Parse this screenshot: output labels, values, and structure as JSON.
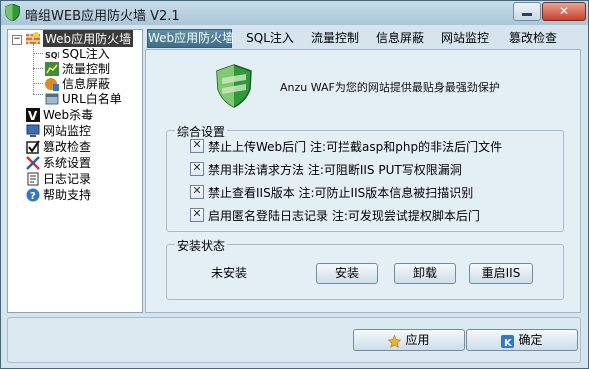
{
  "window": {
    "title": "暗组WEB应用防火墙 V2.1",
    "app_icon": "green-shield-icon",
    "close_glyph": "✕"
  },
  "tree": {
    "nodes": [
      {
        "label": "Web应用防火墙",
        "icon": "firewall-icon",
        "selected": true,
        "expanded": true
      },
      {
        "label": "SQL注入",
        "icon": "sql-icon"
      },
      {
        "label": "流量控制",
        "icon": "chart-icon"
      },
      {
        "label": "信息屏蔽",
        "icon": "shield-block-icon"
      },
      {
        "label": "URL白名单",
        "icon": "url-icon"
      },
      {
        "label": "Web杀毒",
        "icon": "virus-v-icon"
      },
      {
        "label": "网站监控",
        "icon": "monitor-icon"
      },
      {
        "label": "篡改检查",
        "icon": "checkbox-check-icon"
      },
      {
        "label": "系统设置",
        "icon": "tools-icon"
      },
      {
        "label": "日志记录",
        "icon": "log-icon"
      },
      {
        "label": "帮助支持",
        "icon": "help-icon"
      }
    ]
  },
  "tabs": [
    {
      "label": "Web应用防火墙",
      "active": true
    },
    {
      "label": "SQL注入"
    },
    {
      "label": "流量控制"
    },
    {
      "label": "信息屏蔽"
    },
    {
      "label": "网站监控"
    },
    {
      "label": "篡改检查"
    }
  ],
  "header": {
    "slogan": "Anzu WAF为您的网站提供最贴身最强劲保护",
    "logo": "green-shield-logo"
  },
  "settings": {
    "title": "综合设置",
    "options": [
      {
        "label": "禁止上传Web后门 注:可拦截asp和php的非法后门文件",
        "checked": true
      },
      {
        "label": "禁用非法请求方法  注:可阻断IIS PUT写权限漏洞",
        "checked": true
      },
      {
        "label": "禁止查看IIS版本  注:可防止IIS版本信息被扫描识别",
        "checked": true
      },
      {
        "label": "启用匿名登陆日志记录  注:可发现尝试提权脚本后门",
        "checked": true
      }
    ]
  },
  "install": {
    "title": "安装状态",
    "status": "未安装",
    "install_label": "安装",
    "uninstall_label": "卸载",
    "restart_label": "重启IIS"
  },
  "footer": {
    "apply_label": "应用",
    "ok_label": "确定"
  },
  "colors": {
    "accent": "#3e6d88",
    "shield_green": "#2e9a3a"
  }
}
